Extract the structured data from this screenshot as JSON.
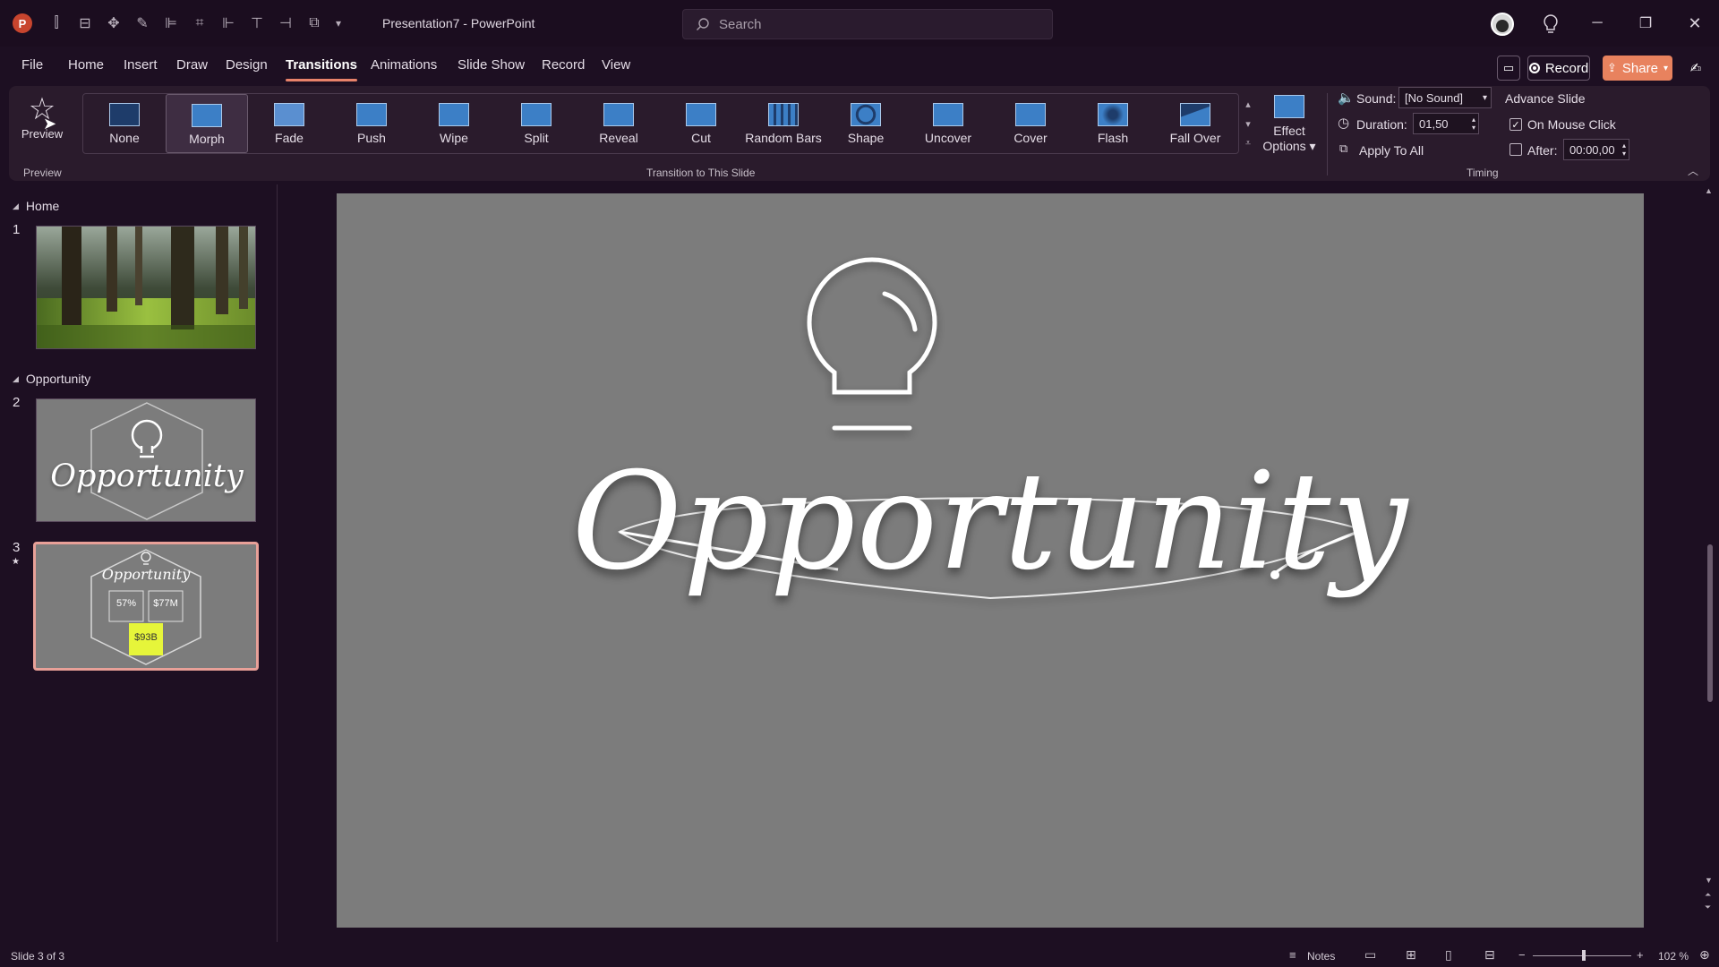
{
  "app": {
    "logo_letter": "P",
    "title": "Presentation7  -  PowerPoint",
    "search_placeholder": "Search"
  },
  "menu": {
    "tabs": [
      "File",
      "Home",
      "Insert",
      "Draw",
      "Design",
      "Transitions",
      "Animations",
      "Slide Show",
      "Record",
      "View"
    ],
    "active_tab": "Transitions",
    "record_label": "Record",
    "share_label": "Share"
  },
  "ribbon": {
    "preview_label": "Preview",
    "preview_group": "Preview",
    "transitions_group": "Transition to This Slide",
    "transitions": [
      "None",
      "Morph",
      "Fade",
      "Push",
      "Wipe",
      "Split",
      "Reveal",
      "Cut",
      "Random Bars",
      "Shape",
      "Uncover",
      "Cover",
      "Flash",
      "Fall Over"
    ],
    "selected_transition": "Morph",
    "effect_options_line1": "Effect",
    "effect_options_line2": "Options",
    "sound_label": "Sound:",
    "sound_value": "[No Sound]",
    "duration_label": "Duration:",
    "duration_value": "01,50",
    "apply_all_label": "Apply To All",
    "advance_slide_label": "Advance Slide",
    "on_mouse_click_label": "On Mouse Click",
    "on_mouse_click_checked": true,
    "after_label": "After:",
    "after_value": "00:00,00",
    "after_checked": false,
    "timing_group": "Timing"
  },
  "sections": [
    {
      "name": "Home"
    },
    {
      "name": "Opportunity"
    }
  ],
  "slides": [
    {
      "number": "1"
    },
    {
      "number": "2",
      "title": "Opportunity"
    },
    {
      "number": "3",
      "title": "Opportunity",
      "stat1": "57%",
      "stat2": "$77M",
      "stat3": "$93B"
    }
  ],
  "main_slide": {
    "title": "Opportunity"
  },
  "status": {
    "slide_info": "Slide 3 of 3",
    "notes_label": "Notes",
    "zoom": "102 %",
    "zoom_level": 0.52
  },
  "colors": {
    "accent": "#e8826a",
    "share_bg": "#e8825e",
    "selected_thumb_border": "#e8a098",
    "slide_bg": "#7c7c7c",
    "highlight_tile": "#e6f53a"
  }
}
